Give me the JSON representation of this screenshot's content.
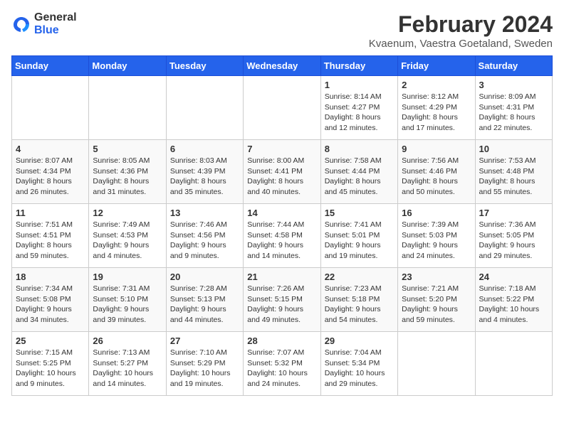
{
  "logo": {
    "general": "General",
    "blue": "Blue"
  },
  "title": "February 2024",
  "subtitle": "Kvaenum, Vaestra Goetaland, Sweden",
  "days_header": [
    "Sunday",
    "Monday",
    "Tuesday",
    "Wednesday",
    "Thursday",
    "Friday",
    "Saturday"
  ],
  "weeks": [
    [
      {
        "day": "",
        "info": ""
      },
      {
        "day": "",
        "info": ""
      },
      {
        "day": "",
        "info": ""
      },
      {
        "day": "",
        "info": ""
      },
      {
        "day": "1",
        "info": "Sunrise: 8:14 AM\nSunset: 4:27 PM\nDaylight: 8 hours\nand 12 minutes."
      },
      {
        "day": "2",
        "info": "Sunrise: 8:12 AM\nSunset: 4:29 PM\nDaylight: 8 hours\nand 17 minutes."
      },
      {
        "day": "3",
        "info": "Sunrise: 8:09 AM\nSunset: 4:31 PM\nDaylight: 8 hours\nand 22 minutes."
      }
    ],
    [
      {
        "day": "4",
        "info": "Sunrise: 8:07 AM\nSunset: 4:34 PM\nDaylight: 8 hours\nand 26 minutes."
      },
      {
        "day": "5",
        "info": "Sunrise: 8:05 AM\nSunset: 4:36 PM\nDaylight: 8 hours\nand 31 minutes."
      },
      {
        "day": "6",
        "info": "Sunrise: 8:03 AM\nSunset: 4:39 PM\nDaylight: 8 hours\nand 35 minutes."
      },
      {
        "day": "7",
        "info": "Sunrise: 8:00 AM\nSunset: 4:41 PM\nDaylight: 8 hours\nand 40 minutes."
      },
      {
        "day": "8",
        "info": "Sunrise: 7:58 AM\nSunset: 4:44 PM\nDaylight: 8 hours\nand 45 minutes."
      },
      {
        "day": "9",
        "info": "Sunrise: 7:56 AM\nSunset: 4:46 PM\nDaylight: 8 hours\nand 50 minutes."
      },
      {
        "day": "10",
        "info": "Sunrise: 7:53 AM\nSunset: 4:48 PM\nDaylight: 8 hours\nand 55 minutes."
      }
    ],
    [
      {
        "day": "11",
        "info": "Sunrise: 7:51 AM\nSunset: 4:51 PM\nDaylight: 8 hours\nand 59 minutes."
      },
      {
        "day": "12",
        "info": "Sunrise: 7:49 AM\nSunset: 4:53 PM\nDaylight: 9 hours\nand 4 minutes."
      },
      {
        "day": "13",
        "info": "Sunrise: 7:46 AM\nSunset: 4:56 PM\nDaylight: 9 hours\nand 9 minutes."
      },
      {
        "day": "14",
        "info": "Sunrise: 7:44 AM\nSunset: 4:58 PM\nDaylight: 9 hours\nand 14 minutes."
      },
      {
        "day": "15",
        "info": "Sunrise: 7:41 AM\nSunset: 5:01 PM\nDaylight: 9 hours\nand 19 minutes."
      },
      {
        "day": "16",
        "info": "Sunrise: 7:39 AM\nSunset: 5:03 PM\nDaylight: 9 hours\nand 24 minutes."
      },
      {
        "day": "17",
        "info": "Sunrise: 7:36 AM\nSunset: 5:05 PM\nDaylight: 9 hours\nand 29 minutes."
      }
    ],
    [
      {
        "day": "18",
        "info": "Sunrise: 7:34 AM\nSunset: 5:08 PM\nDaylight: 9 hours\nand 34 minutes."
      },
      {
        "day": "19",
        "info": "Sunrise: 7:31 AM\nSunset: 5:10 PM\nDaylight: 9 hours\nand 39 minutes."
      },
      {
        "day": "20",
        "info": "Sunrise: 7:28 AM\nSunset: 5:13 PM\nDaylight: 9 hours\nand 44 minutes."
      },
      {
        "day": "21",
        "info": "Sunrise: 7:26 AM\nSunset: 5:15 PM\nDaylight: 9 hours\nand 49 minutes."
      },
      {
        "day": "22",
        "info": "Sunrise: 7:23 AM\nSunset: 5:18 PM\nDaylight: 9 hours\nand 54 minutes."
      },
      {
        "day": "23",
        "info": "Sunrise: 7:21 AM\nSunset: 5:20 PM\nDaylight: 9 hours\nand 59 minutes."
      },
      {
        "day": "24",
        "info": "Sunrise: 7:18 AM\nSunset: 5:22 PM\nDaylight: 10 hours\nand 4 minutes."
      }
    ],
    [
      {
        "day": "25",
        "info": "Sunrise: 7:15 AM\nSunset: 5:25 PM\nDaylight: 10 hours\nand 9 minutes."
      },
      {
        "day": "26",
        "info": "Sunrise: 7:13 AM\nSunset: 5:27 PM\nDaylight: 10 hours\nand 14 minutes."
      },
      {
        "day": "27",
        "info": "Sunrise: 7:10 AM\nSunset: 5:29 PM\nDaylight: 10 hours\nand 19 minutes."
      },
      {
        "day": "28",
        "info": "Sunrise: 7:07 AM\nSunset: 5:32 PM\nDaylight: 10 hours\nand 24 minutes."
      },
      {
        "day": "29",
        "info": "Sunrise: 7:04 AM\nSunset: 5:34 PM\nDaylight: 10 hours\nand 29 minutes."
      },
      {
        "day": "",
        "info": ""
      },
      {
        "day": "",
        "info": ""
      }
    ]
  ]
}
